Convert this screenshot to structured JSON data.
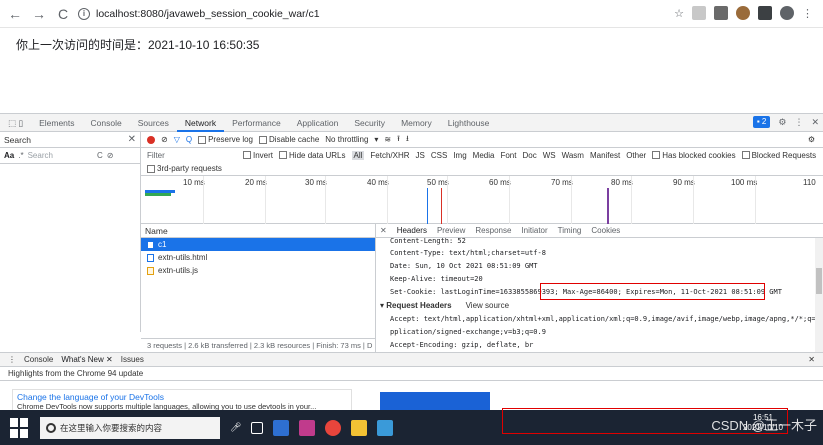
{
  "browser": {
    "url": "localhost:8080/javaweb_session_cookie_war/c1"
  },
  "page": {
    "text": "你上一次访问的时间是：2021-10-10 16:50:35"
  },
  "devtools": {
    "tabs": [
      "Elements",
      "Console",
      "Sources",
      "Network",
      "Performance",
      "Application",
      "Security",
      "Memory",
      "Lighthouse"
    ],
    "active_tab": "Network",
    "issues_badge": "2",
    "search_panel": {
      "title": "Search",
      "aa_label": "Aa",
      "regex_label": ".*",
      "placeholder": "Search"
    },
    "toolbar": {
      "preserve_log": "Preserve log",
      "disable_cache": "Disable cache",
      "throttling": "No throttling"
    },
    "filter": {
      "label": "Filter",
      "invert": "Invert",
      "hide_data_urls": "Hide data URLs",
      "types": [
        "All",
        "Fetch/XHR",
        "JS",
        "CSS",
        "Img",
        "Media",
        "Font",
        "Doc",
        "WS",
        "Wasm",
        "Manifest",
        "Other"
      ],
      "blocked_cookies": "Has blocked cookies",
      "blocked_requests": "Blocked Requests",
      "third_party": "3rd-party requests"
    },
    "timeline_ticks": [
      "10 ms",
      "20 ms",
      "30 ms",
      "40 ms",
      "50 ms",
      "60 ms",
      "70 ms",
      "80 ms",
      "90 ms",
      "100 ms",
      "110"
    ],
    "requests": {
      "header": "Name",
      "items": [
        "c1",
        "extn-utils.html",
        "extn-utils.js"
      ],
      "footer": "3 requests  |  2.6 kB transferred  |  2.3 kB resources  |  Finish: 73 ms  |  D"
    },
    "headers_panel": {
      "tabs": [
        "Headers",
        "Preview",
        "Response",
        "Initiator",
        "Timing",
        "Cookies"
      ],
      "lines": [
        "Content-Length: 52",
        "Content-Type: text/html;charset=utf-8",
        "Date: Sun, 10 Oct 2021 08:51:09 GMT",
        "Keep-Alive: timeout=20",
        "Set-Cookie: lastLoginTime=1633855869393; Max-Age=86400; Expires=Mon, 11-Oct-2021 08:51:09 GMT"
      ],
      "request_headers_title": "Request Headers",
      "view_source": "View source",
      "request_lines": [
        "Accept: text/html,application/xhtml+xml,application/xml;q=0.9,image/avif,image/webp,image/apng,*/*;q=0.8,a",
        "pplication/signed-exchange;v=b3;q=0.9",
        "Accept-Encoding: gzip, deflate, br"
      ]
    },
    "drawer": {
      "tabs": [
        "Console",
        "What's New",
        "Issues"
      ],
      "highlights": "Highlights from the Chrome 94 update",
      "change_language": "Change the language of your DevTools",
      "change_language_sub": "Chrome DevTools now supports multiple languages, allowing you to use devtools in your..."
    }
  },
  "taskbar": {
    "search_placeholder": "在这里输入你要搜索的内容",
    "time": "16:51",
    "date": "2021/10/10",
    "watermark": "CSDN @王一木子"
  }
}
